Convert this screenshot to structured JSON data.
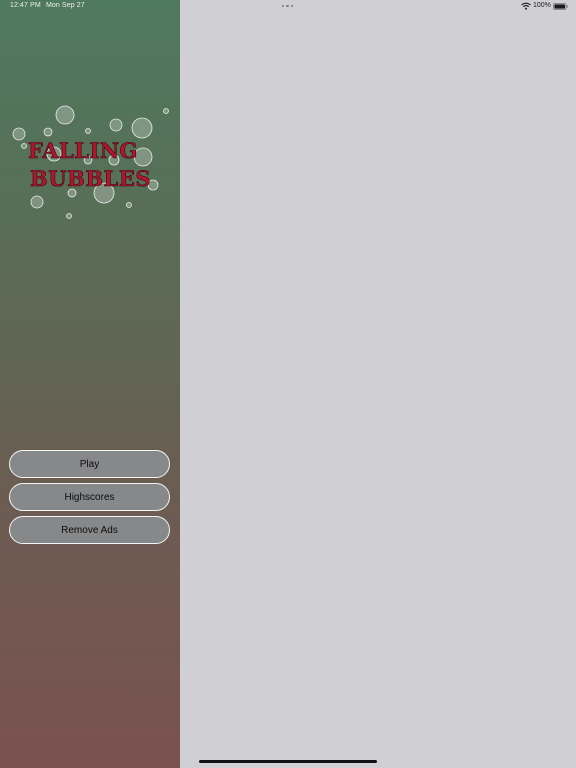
{
  "status_bar": {
    "time": "12:47 PM",
    "date": "Mon Sep 27",
    "battery": "100%",
    "icons": [
      "multitasking-dots-icon",
      "wifi-icon",
      "battery-icon"
    ]
  },
  "game": {
    "logo_line_1": "FALLING",
    "logo_line_2": "BUBBLES"
  },
  "menu": {
    "play_label": "Play",
    "highscores_label": "Highscores",
    "remove_ads_label": "Remove Ads"
  },
  "colors": {
    "sidebar_top": "#4f7a5e",
    "sidebar_bottom": "#7b524f",
    "main_panel": "#d0cfd3",
    "logo_red": "#b0162d",
    "button_fill": "#87888a"
  }
}
